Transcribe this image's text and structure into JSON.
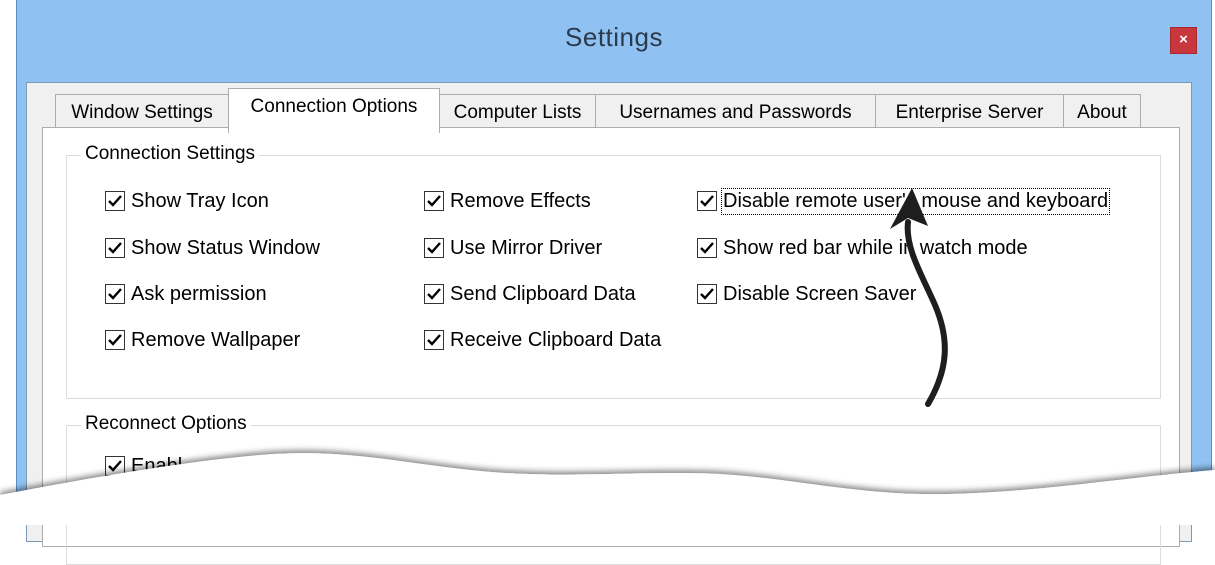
{
  "window": {
    "title": "Settings",
    "close_label": "×"
  },
  "tabs": [
    {
      "label": "Window Settings",
      "active": false
    },
    {
      "label": "Connection Options",
      "active": true
    },
    {
      "label": "Computer Lists",
      "active": false
    },
    {
      "label": "Usernames and Passwords",
      "active": false
    },
    {
      "label": "Enterprise Server",
      "active": false
    },
    {
      "label": "About",
      "active": false
    }
  ],
  "connection_settings": {
    "label": "Connection Settings",
    "col1": [
      {
        "label": "Show Tray Icon",
        "checked": true
      },
      {
        "label": "Show Status Window",
        "checked": true
      },
      {
        "label": "Ask permission",
        "checked": true
      },
      {
        "label": "Remove Wallpaper",
        "checked": true
      }
    ],
    "col2": [
      {
        "label": "Remove Effects",
        "checked": true
      },
      {
        "label": "Use Mirror Driver",
        "checked": true
      },
      {
        "label": "Send Clipboard Data",
        "checked": true
      },
      {
        "label": "Receive Clipboard Data",
        "checked": true
      }
    ],
    "col3": [
      {
        "label": "Disable remote user's mouse and keyboard",
        "checked": true
      },
      {
        "label": "Show red bar while in watch mode",
        "checked": true
      },
      {
        "label": "Disable Screen Saver",
        "checked": true
      }
    ]
  },
  "reconnect_options": {
    "label": "Reconnect Options",
    "items": [
      {
        "label": "Enabl",
        "checked": true
      }
    ]
  },
  "colors": {
    "titlebar": "#8fc2f2",
    "close_button": "#c8373d",
    "client": "#f0f0f0"
  },
  "icons": {
    "checkmark": "check-icon",
    "close": "close-icon",
    "annotation": "arrow-annotation-icon"
  }
}
